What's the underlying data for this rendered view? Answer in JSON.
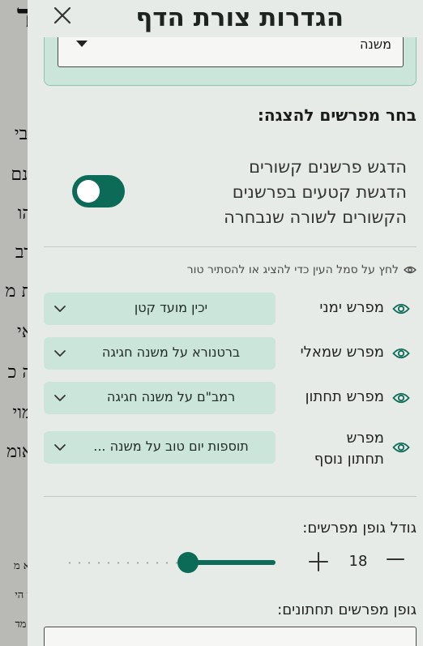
{
  "background": {
    "glyphs": [
      "ד",
      "יבי",
      "ינם",
      "הו",
      "דב",
      "ת מ",
      "אי",
      "ה כ",
      "מוי",
      "אומ",
      "יא מ",
      "ון הי",
      "י מד"
    ]
  },
  "panel": {
    "title": "הגדרות צורת הדף",
    "source_select": {
      "value": "משנה"
    },
    "section_heading": "בחר מפרשים להצגה:",
    "highlight": {
      "title": "הדגש פרשנים קשורים",
      "description": "הדגשת קטעים בפרשנים הקשורים לשורה שנבחרה",
      "enabled": true
    },
    "hint": "לחץ על סמל העין כדי להציג או להסתיר טור",
    "commentaries": [
      {
        "label": "מפרש ימני",
        "value": "יכין מועד קטן",
        "visible": true
      },
      {
        "label": "מפרש שמאלי",
        "value": "ברטנורא על משנה חגיגה",
        "visible": true
      },
      {
        "label": "מפרש תחתון",
        "value": "רמב\"ם על משנה חגיגה",
        "visible": true
      },
      {
        "label": "מפרש תחתון נוסף",
        "value": "תוספות יום טוב על משנה ...",
        "visible": true
      }
    ],
    "font_size": {
      "label": "גודל גופן מפרשים:",
      "value": "18",
      "slider_fraction": 0.58
    },
    "footer_font": {
      "label": "גופן מפרשים תחתונים:"
    }
  },
  "colors": {
    "accent": "#0c6b57",
    "chip": "#cce5da",
    "panel_bg": "#e6ebe7"
  },
  "icons": {
    "close": "close-icon",
    "eye": "eye-icon",
    "chevron": "chevron-down-icon",
    "plus": "plus-icon",
    "minus": "minus-icon"
  }
}
